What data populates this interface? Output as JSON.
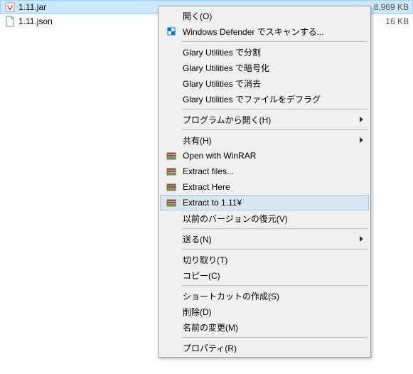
{
  "files": [
    {
      "name": "1.11.jar",
      "size": "8,969 KB",
      "icon": "jar-icon",
      "selected": true
    },
    {
      "name": "1.11.json",
      "size": "16 KB",
      "icon": "json-icon",
      "selected": false
    }
  ],
  "menu": {
    "open": "開く(O)",
    "defender": "Windows Defender でスキャンする...",
    "glary_split": "Glary Utilities で分割",
    "glary_encrypt": "Glary Utilities で暗号化",
    "glary_erase": "Glary Utilities で消去",
    "glary_defrag": "Glary Utilities でファイルをデフラグ",
    "open_with": "プログラムから開く(H)",
    "share": "共有(H)",
    "winrar_open": "Open with WinRAR",
    "winrar_extract_files": "Extract files...",
    "winrar_extract_here": "Extract Here",
    "winrar_extract_to": "Extract to 1.11¥",
    "restore_version": "以前のバージョンの復元(V)",
    "send_to": "送る(N)",
    "cut": "切り取り(T)",
    "copy": "コピー(C)",
    "shortcut": "ショートカットの作成(S)",
    "delete": "削除(D)",
    "rename": "名前の変更(M)",
    "properties": "プロパティ(R)"
  }
}
